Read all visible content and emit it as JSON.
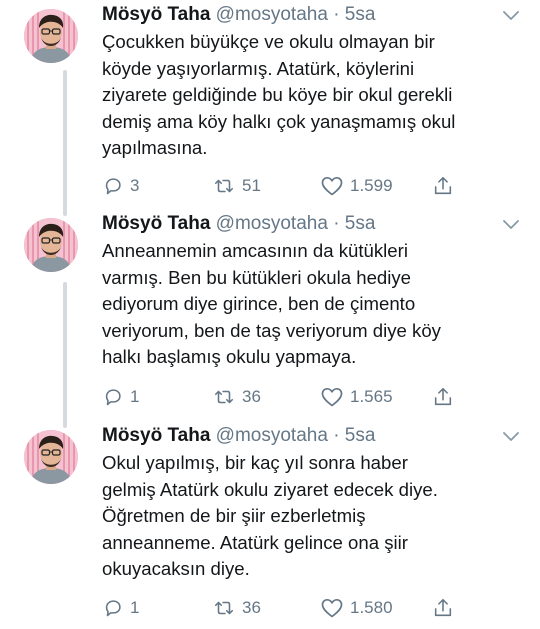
{
  "tweets": [
    {
      "name": "Mösyö Taha",
      "handle": "@mosyotaha",
      "separator": "·",
      "time": "5sa",
      "text": "Çocukken büyükçe ve okulu olmayan bir\nköyde yaşıyorlarmış. Atatürk, köylerini\nziyarete geldiğinde bu köye bir okul gerekli\ndemiş ama köy halkı çok yanaşmamış okul\nyapılmasına.",
      "replies": "3",
      "retweets": "51",
      "likes": "1.599"
    },
    {
      "name": "Mösyö Taha",
      "handle": "@mosyotaha",
      "separator": "·",
      "time": "5sa",
      "text": "Anneannemin amcasının da kütükleri\nvarmış. Ben bu kütükleri okula hediye\nediyorum diye girince,   ben de çimento\nveriyorum, ben de taş veriyorum diye köy\nhalkı başlamış okulu yapmaya.",
      "replies": "1",
      "retweets": "36",
      "likes": "1.565"
    },
    {
      "name": "Mösyö Taha",
      "handle": "@mosyotaha",
      "separator": "·",
      "time": "5sa",
      "text": "Okul yapılmış, bir kaç yıl sonra haber\ngelmiş Atatürk okulu ziyaret edecek diye.\nÖğretmen de bir şiir ezberletmiş\nanneanneme. Atatürk gelince ona şiir\nokuyacaksın diye.",
      "replies": "1",
      "retweets": "36",
      "likes": "1.580"
    }
  ],
  "icons": {
    "reply": "reply-icon",
    "retweet": "retweet-icon",
    "like": "heart-icon",
    "share": "share-icon",
    "caret": "chevron-down-icon",
    "avatar": "profile-photo"
  },
  "colors": {
    "text": "#14171a",
    "secondary": "#657786",
    "thread_line": "#d4dadf",
    "avatar_bg": "#f3b9c9"
  }
}
